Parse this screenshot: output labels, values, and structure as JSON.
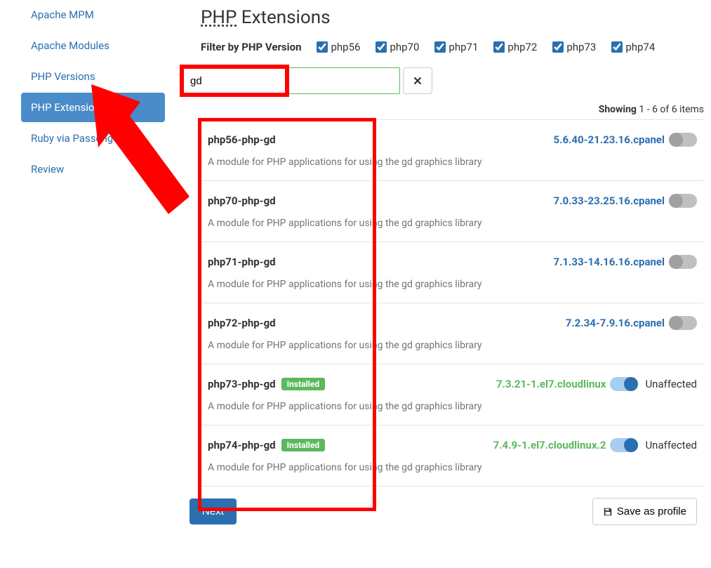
{
  "sidebar": {
    "items": [
      {
        "label": "Apache MPM",
        "active": false
      },
      {
        "label": "Apache Modules",
        "active": false
      },
      {
        "label": "PHP Versions",
        "active": false
      },
      {
        "label": "PHP Extensions",
        "active": true
      },
      {
        "label": "Ruby via Passenger",
        "active": false
      },
      {
        "label": "Review",
        "active": false
      }
    ]
  },
  "header": {
    "title_prefix": "PHP",
    "title_suffix": " Extensions"
  },
  "filter": {
    "label": "Filter by PHP Version",
    "options": [
      {
        "label": "php56",
        "checked": true
      },
      {
        "label": "php70",
        "checked": true
      },
      {
        "label": "php71",
        "checked": true
      },
      {
        "label": "php72",
        "checked": true
      },
      {
        "label": "php73",
        "checked": true
      },
      {
        "label": "php74",
        "checked": true
      }
    ]
  },
  "search": {
    "value": "gd"
  },
  "results": {
    "showing_label": "Showing",
    "showing_count": " 1 - 6 of 6 items",
    "items": [
      {
        "name": "php56-php-gd",
        "installed": false,
        "version": "5.6.40-21.23.16.cpanel",
        "version_color": "blue",
        "toggle_on": false,
        "status": "",
        "desc": "A module for PHP applications for using the gd graphics library"
      },
      {
        "name": "php70-php-gd",
        "installed": false,
        "version": "7.0.33-23.25.16.cpanel",
        "version_color": "blue",
        "toggle_on": false,
        "status": "",
        "desc": "A module for PHP applications for using the gd graphics library"
      },
      {
        "name": "php71-php-gd",
        "installed": false,
        "version": "7.1.33-14.16.16.cpanel",
        "version_color": "blue",
        "toggle_on": false,
        "status": "",
        "desc": "A module for PHP applications for using the gd graphics library"
      },
      {
        "name": "php72-php-gd",
        "installed": false,
        "version": "7.2.34-7.9.16.cpanel",
        "version_color": "blue",
        "toggle_on": false,
        "status": "",
        "desc": "A module for PHP applications for using the gd graphics library"
      },
      {
        "name": "php73-php-gd",
        "installed": true,
        "version": "7.3.21-1.el7.cloudlinux",
        "version_color": "green",
        "toggle_on": true,
        "status": "Unaffected",
        "desc": "A module for PHP applications for using the gd graphics library"
      },
      {
        "name": "php74-php-gd",
        "installed": true,
        "version": "7.4.9-1.el7.cloudlinux.2",
        "version_color": "green",
        "toggle_on": true,
        "status": "Unaffected",
        "desc": "A module for PHP applications for using the gd graphics library"
      }
    ]
  },
  "badges": {
    "installed": "Installed"
  },
  "footer": {
    "next": "Next",
    "save": "Save as profile"
  }
}
